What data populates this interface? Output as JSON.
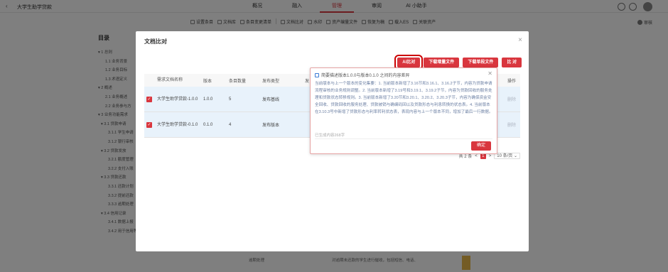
{
  "app": {
    "title": "大学生助学贷款",
    "nav": [
      "概况",
      "融入",
      "管理",
      "审阅",
      "AI 小助手"
    ],
    "nav_active_index": 2
  },
  "toolbar": {
    "items": [
      "设置条目",
      "文档库",
      "条目变更清单",
      "文档比对",
      "水印",
      "资产编量文件",
      "恢复为稿",
      "载入ES",
      "关联资产"
    ],
    "right_label": "审核"
  },
  "toc": {
    "title": "目录",
    "items": [
      "▾ 1 总则",
      "1.1 业务背景",
      "1.2 业务目标",
      "1.3 术语定义",
      "▾ 2 概述",
      "2.1 业务概述",
      "2.2 业务参与方",
      "▾ 3 业务功能需求",
      "▾ 3.1 贷款申请",
      "3.1.1 学生申请",
      "3.1.2 银行审核",
      "▾ 3.2 贷款发放",
      "3.2.1 额度管理",
      "3.2.2 支付入账",
      "▾ 3.3 贷款还款",
      "3.3.1 还款计划",
      "3.3.2 提前还款",
      "3.3.3 逾期处理",
      "▾ 3.4 信用记录",
      "3.4.1 数据上报",
      "3.4.2 用于信用等级的查询"
    ]
  },
  "background_table": {
    "cell_a": "逾期处理",
    "cell_b": "对逾期未还款的学生进行催收，包括短信、电话、"
  },
  "modal": {
    "title": "文档比对",
    "close": "×",
    "buttons": {
      "ai": "AI比对",
      "download_incr": "下载增量文件",
      "download_single": "下载单段文件",
      "compare": "比 对"
    },
    "table": {
      "headers": [
        "需求文档名称",
        "版本",
        "条目数量",
        "发布类型",
        "发",
        "操作"
      ],
      "rows": [
        {
          "name": "大学生助学贷款-1.0.0",
          "version": "1.0.0",
          "count": "5",
          "type": "发布基线",
          "op": "删除"
        },
        {
          "name": "大学生助学贷款-0.1.0",
          "version": "0.1.0",
          "count": "4",
          "type": "发布版本",
          "op": "删除"
        }
      ]
    },
    "pager": {
      "total": "共 2 条",
      "prev": "<",
      "page": "1",
      "next": ">",
      "size": "10 条/页 ⌄"
    }
  },
  "ai_popover": {
    "title": "简要描述版本1.0.0与版本0.1.0 之间的内容差异",
    "close": "✕",
    "body": "当前版本与上一个版本的变化集要：1. 当前版本新增了3.16节和3.16.1、3.16.2子节，内容为贷款申请流程审核的业务规则调整。2. 当前版本新增了3.19号和3.19.1、3.19.2子节，内容为贷款回收的服务处理和贷款状态转移规则。3. 当前版本新增了3.20节和3.20.1、3.20.2、3.20.3子节，内容为确保资金安全回收、贷款回收的服务处理、贷款被销与确编码回以及贷款形态与利息转换的状态表。4. 当前版本在3.10.3号中新增了贷款形态与利率转利状态表，表现内容与上一个版本不同，增加了最后一行数据。",
    "hint": "已生成内容268字",
    "ok": "确定"
  },
  "colors": {
    "accent": "#d9363e",
    "row_selected": "#e8f2fb",
    "overlay": "rgba(0,0,0,0.5)"
  }
}
